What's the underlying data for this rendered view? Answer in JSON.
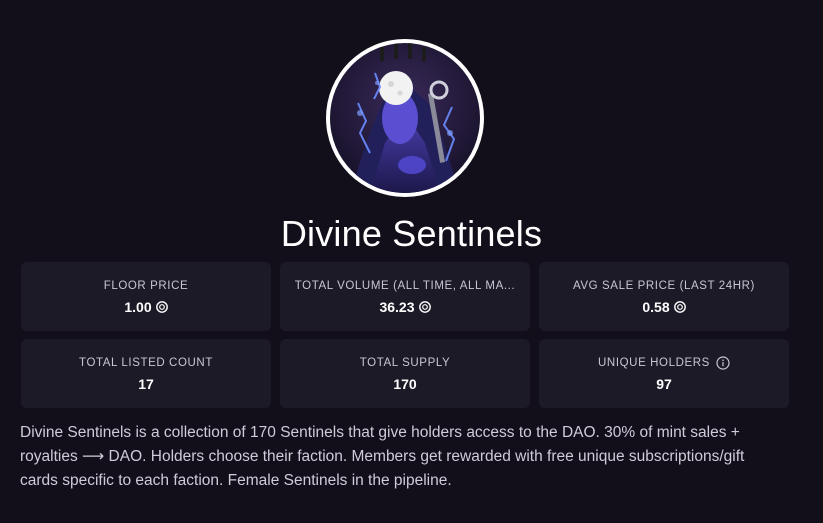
{
  "collection": {
    "name": "Divine Sentinels",
    "description": "Divine Sentinels is a collection of 170 Sentinels that give holders access to the DAO. 30% of mint sales + royalties ⟶ DAO. Holders choose their faction. Members get rewarded with free unique subscriptions/gift cards specific to each faction. Female Sentinels in the pipeline."
  },
  "stats": [
    {
      "label": "FLOOR PRICE",
      "value": "1.00",
      "icon": "solana-coin-icon"
    },
    {
      "label": "TOTAL VOLUME (ALL TIME, ALL MA...",
      "value": "36.23",
      "icon": "solana-coin-icon"
    },
    {
      "label": "AVG SALE PRICE (LAST 24HR)",
      "value": "0.58",
      "icon": "solana-coin-icon"
    },
    {
      "label": "TOTAL LISTED COUNT",
      "value": "17"
    },
    {
      "label": "TOTAL SUPPLY",
      "value": "170"
    },
    {
      "label": "UNIQUE HOLDERS",
      "value": "97",
      "label_icon": "info-icon"
    }
  ],
  "colors": {
    "background": "#130f1a",
    "card": "#1d1a28",
    "text": "#ffffff",
    "muted": "#c9c5d3"
  }
}
